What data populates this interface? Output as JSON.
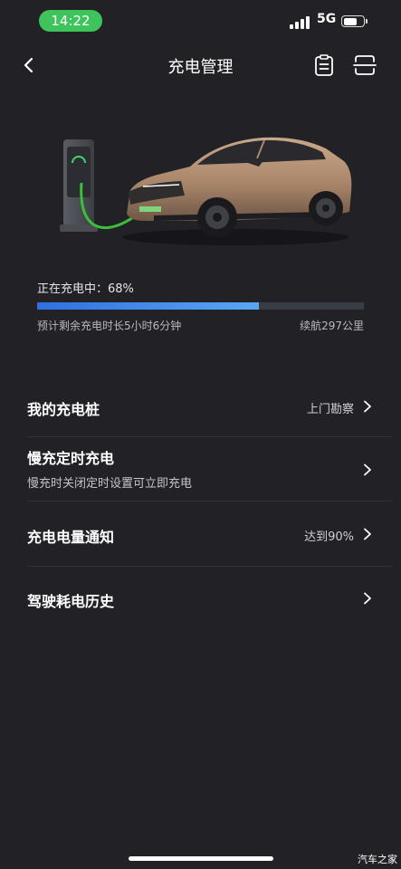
{
  "status_bar": {
    "time": "14:22",
    "network": "5G",
    "time_pill_color": "#3ec45b"
  },
  "nav": {
    "title": "充电管理",
    "back_icon": "chevron-left-icon",
    "clipboard_icon": "clipboard-icon",
    "scan_icon": "scan-icon"
  },
  "charging": {
    "status": "正在充电中：68%",
    "progress": 0.68,
    "remaining": "预计剩余充电时长5小时6分钟",
    "range": "续航297公里",
    "progress_color": "#3d86ee"
  },
  "list": [
    {
      "title": "我的充电桩",
      "value": "上门勘察"
    },
    {
      "title": "慢充定时充电",
      "subtitle": "慢充时关闭定时设置可立即充电"
    },
    {
      "title": "充电电量通知",
      "value": "达到90%"
    },
    {
      "title": "驾驶耗电历史"
    }
  ],
  "watermark": "汽车之家"
}
